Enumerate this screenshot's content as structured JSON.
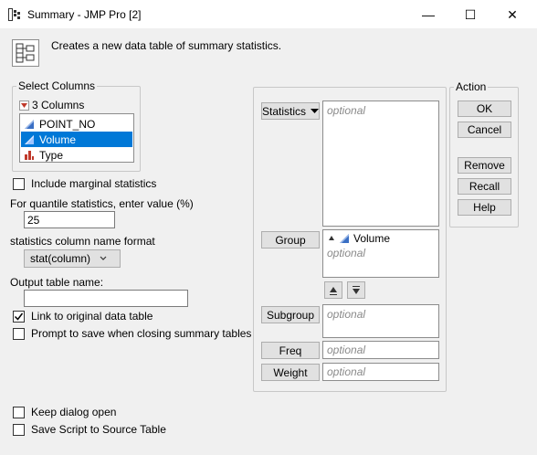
{
  "window": {
    "title": "Summary - JMP Pro [2]",
    "minimize_glyph": "—",
    "maximize_glyph": "☐",
    "close_glyph": "✕"
  },
  "header": {
    "description": "Creates a new data table of summary statistics."
  },
  "select_columns": {
    "label": "Select Columns",
    "count_label": "3 Columns",
    "columns": [
      {
        "name": "POINT_NO",
        "icon": "continuous-column-icon",
        "selected": false
      },
      {
        "name": "Volume",
        "icon": "continuous-column-icon",
        "selected": true
      },
      {
        "name": "Type",
        "icon": "nominal-column-icon",
        "selected": false
      }
    ]
  },
  "options": {
    "include_marginal": {
      "label": "Include marginal statistics",
      "checked": false
    },
    "quantile_label": "For quantile statistics, enter value (%)",
    "quantile_value": "25",
    "name_format_label": "statistics column name format",
    "name_format_value": "stat(column)",
    "output_name_label": "Output table name:",
    "output_name_value": "",
    "link_original": {
      "label": "Link to original data table",
      "checked": true
    },
    "prompt_save": {
      "label": "Prompt to save when closing summary tables",
      "checked": false
    },
    "keep_open": {
      "label": "Keep dialog open",
      "checked": false
    },
    "save_script": {
      "label": "Save Script to Source Table",
      "checked": false
    }
  },
  "roles": {
    "statistics": {
      "label": "Statistics",
      "placeholder": "optional"
    },
    "group": {
      "label": "Group",
      "item": "Volume",
      "placeholder": "optional"
    },
    "subgroup": {
      "label": "Subgroup",
      "placeholder": "optional"
    },
    "freq": {
      "label": "Freq",
      "placeholder": "optional"
    },
    "weight": {
      "label": "Weight",
      "placeholder": "optional"
    }
  },
  "action": {
    "label": "Action",
    "ok": "OK",
    "cancel": "Cancel",
    "remove": "Remove",
    "recall": "Recall",
    "help": "Help"
  },
  "colors": {
    "selection": "#0078d7",
    "dialog_bg": "#f0f0f0",
    "nominal_icon": "#c0392b"
  }
}
